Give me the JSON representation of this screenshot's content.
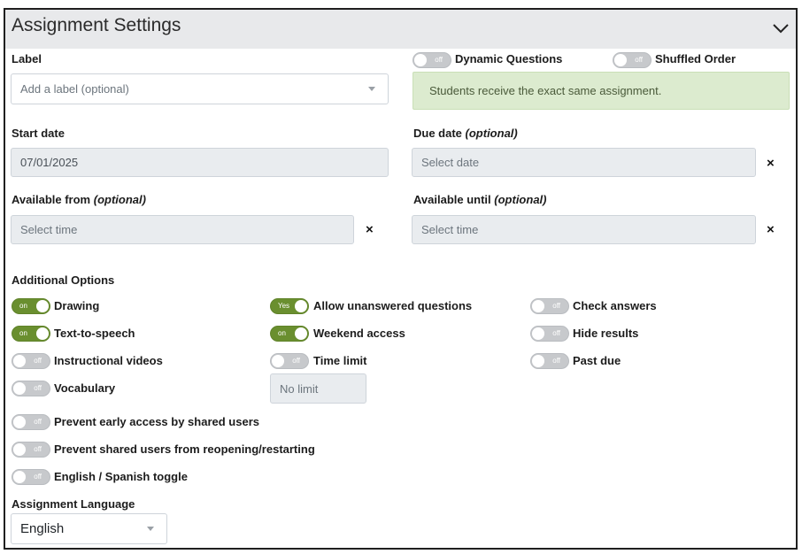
{
  "header": {
    "title": "Assignment Settings",
    "collapse_icon": "chevron-down-icon"
  },
  "label_field": {
    "label": "Label",
    "placeholder": "Add a label (optional)"
  },
  "top_toggles": [
    {
      "label": "Dynamic Questions",
      "state": "off"
    },
    {
      "label": "Shuffled Order",
      "state": "off"
    }
  ],
  "info_message": "Students receive the exact same assignment.",
  "start_date": {
    "label": "Start date",
    "value": "07/01/2025"
  },
  "due_date": {
    "label": "Due date",
    "optional": "(optional)",
    "placeholder": "Select date",
    "clear": "×"
  },
  "available_from": {
    "label": "Available from",
    "optional": "(optional)",
    "placeholder": "Select time",
    "clear": "×"
  },
  "available_until": {
    "label": "Available until",
    "optional": "(optional)",
    "placeholder": "Select time",
    "clear": "×"
  },
  "additional_options": {
    "title": "Additional Options",
    "col1": [
      {
        "label": "Drawing",
        "state": "on"
      },
      {
        "label": "Text-to-speech",
        "state": "on"
      },
      {
        "label": "Instructional videos",
        "state": "off"
      },
      {
        "label": "Vocabulary",
        "state": "off"
      }
    ],
    "col2": [
      {
        "label": "Allow unanswered questions",
        "state": "Yes"
      },
      {
        "label": "Weekend access",
        "state": "on"
      },
      {
        "label": "Time limit",
        "state": "off"
      }
    ],
    "time_limit_placeholder": "No limit",
    "col3": [
      {
        "label": "Check answers",
        "state": "off"
      },
      {
        "label": "Hide results",
        "state": "off"
      },
      {
        "label": "Past due",
        "state": "off"
      }
    ],
    "wide": [
      {
        "label": "Prevent early access by shared users",
        "state": "off"
      },
      {
        "label": "Prevent shared users from reopening/restarting",
        "state": "off"
      },
      {
        "label": "English / Spanish toggle",
        "state": "off"
      }
    ]
  },
  "language": {
    "label": "Assignment Language",
    "value": "English"
  },
  "colors": {
    "toggle_on": "#6a8f2f",
    "toggle_off": "#c7c9cc",
    "info_bg": "#dcebcf",
    "header_bg": "#e8e9eb"
  }
}
